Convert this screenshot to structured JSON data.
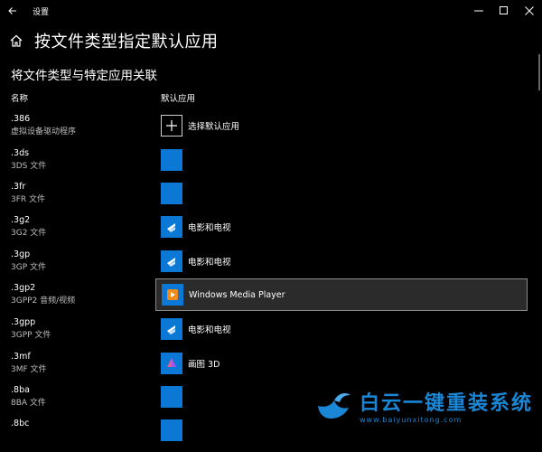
{
  "window": {
    "title": "设置",
    "controls": [
      "minimize",
      "maximize",
      "close"
    ]
  },
  "header": {
    "title": "按文件类型指定默认应用"
  },
  "subtitle": "将文件类型与特定应用关联",
  "columns": {
    "name": "名称",
    "default_app": "默认应用"
  },
  "rows": [
    {
      "ext": ".386",
      "desc": "虚拟设备驱动程序",
      "app": "选择默认应用",
      "icon": "plus-icon"
    },
    {
      "ext": ".3ds",
      "desc": "3DS 文件",
      "app": "",
      "icon": "blank-tile"
    },
    {
      "ext": ".3fr",
      "desc": "3FR 文件",
      "app": "",
      "icon": "blank-tile"
    },
    {
      "ext": ".3g2",
      "desc": "3G2 文件",
      "app": "电影和电视",
      "icon": "movies-tv-icon"
    },
    {
      "ext": ".3gp",
      "desc": "3GP 文件",
      "app": "电影和电视",
      "icon": "movies-tv-icon"
    },
    {
      "ext": ".3gp2",
      "desc": "3GPP2 音频/视频",
      "app": "Windows Media Player",
      "icon": "media-player-icon",
      "selected": true
    },
    {
      "ext": ".3gpp",
      "desc": "3GPP 文件",
      "app": "电影和电视",
      "icon": "movies-tv-icon"
    },
    {
      "ext": ".3mf",
      "desc": "3MF 文件",
      "app": "画图 3D",
      "icon": "paint3d-icon"
    },
    {
      "ext": ".8ba",
      "desc": "8BA 文件",
      "app": "",
      "icon": "blank-tile"
    },
    {
      "ext": ".8bc",
      "desc": "",
      "app": "",
      "icon": "blank-tile"
    }
  ],
  "watermark": {
    "text": "白云一键重装系统",
    "url": "www.baiyunxitong.com"
  },
  "colors": {
    "accent": "#0a78d4",
    "background": "#000000",
    "selected_bg": "#2b2b2b",
    "watermark": "#1a86d6"
  }
}
